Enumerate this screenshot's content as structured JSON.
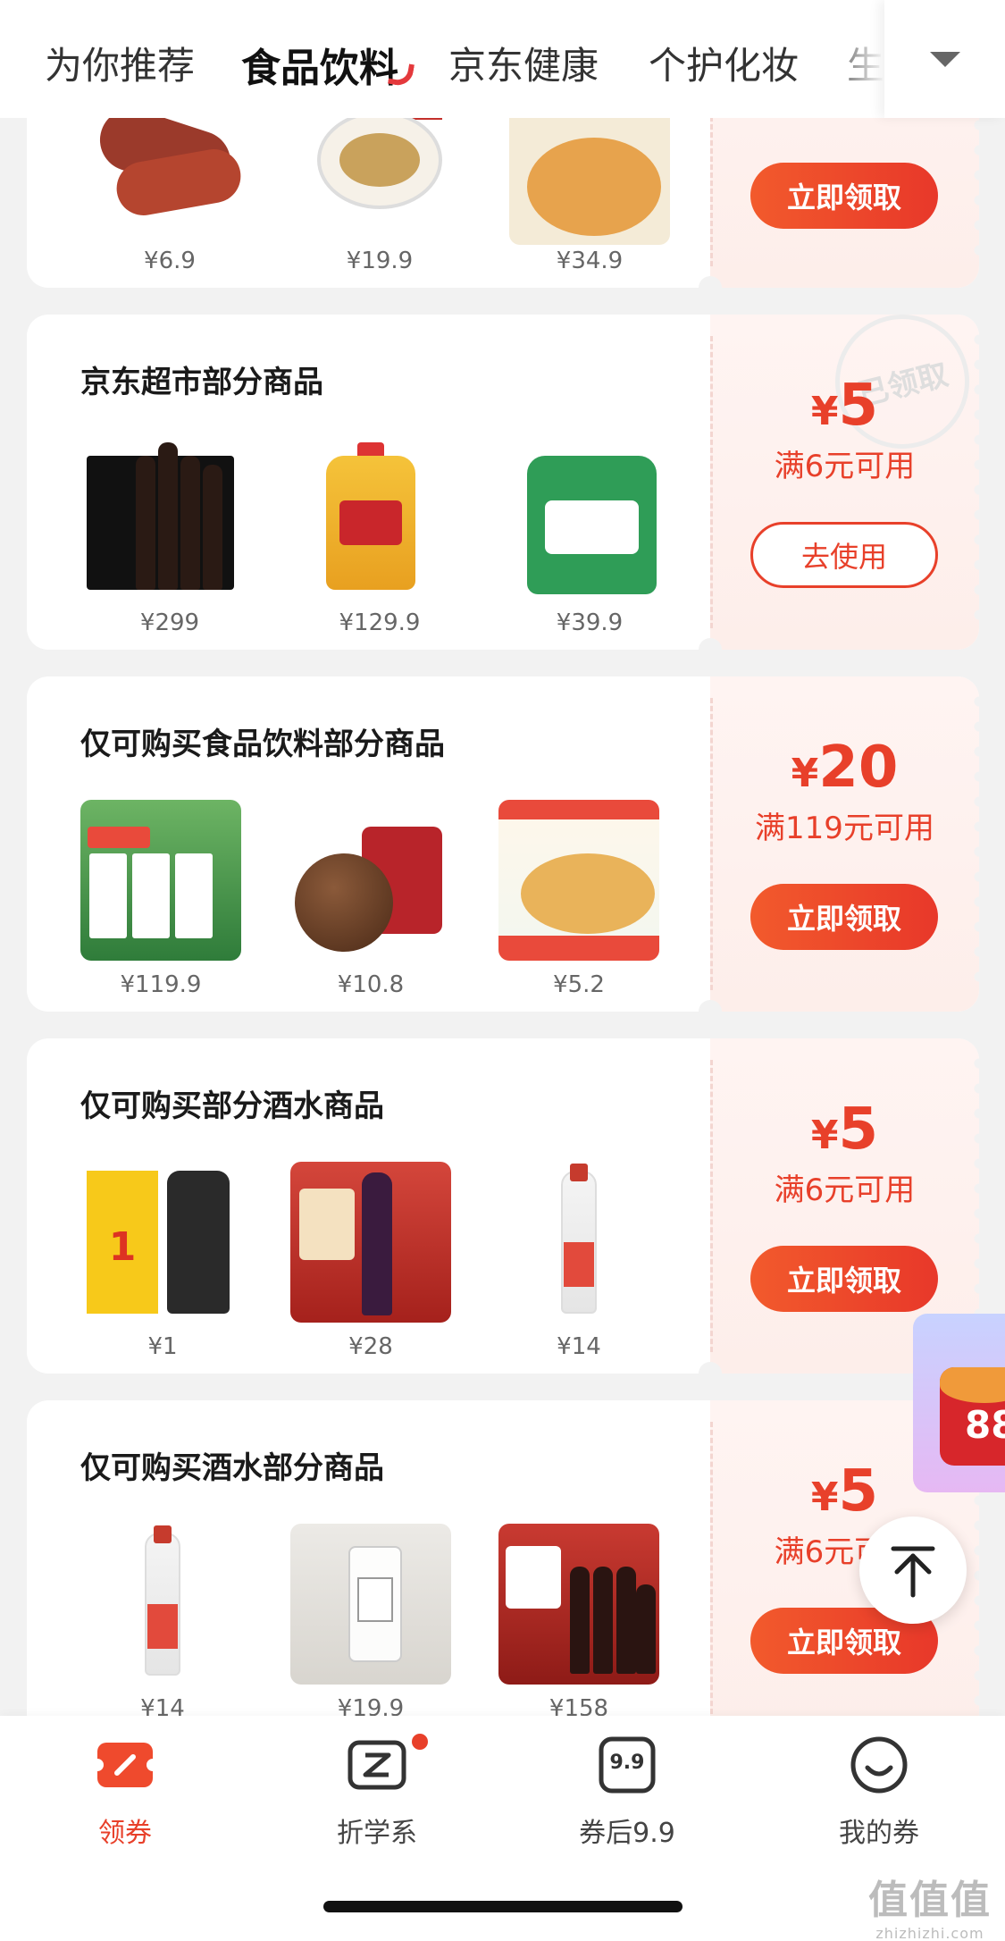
{
  "tabs": [
    {
      "label": "为你推荐",
      "active": false
    },
    {
      "label": "食品饮料",
      "active": true
    },
    {
      "label": "京东健康",
      "active": false
    },
    {
      "label": "个护化妆",
      "active": false
    },
    {
      "label": "生",
      "active": false
    }
  ],
  "cards": [
    {
      "title": "",
      "products": [
        {
          "price": "¥6.9",
          "icon": "sausage-image"
        },
        {
          "price": "¥19.9",
          "icon": "noodle-image"
        },
        {
          "price": "¥34.9",
          "icon": "rice-noodle-image"
        }
      ],
      "button": "立即领取"
    },
    {
      "title": "京东超市部分商品",
      "products": [
        {
          "price": "¥299",
          "icon": "wine-box-image"
        },
        {
          "price": "¥129.9",
          "icon": "cooking-oil-image"
        },
        {
          "price": "¥39.9",
          "icon": "rice-bag-image"
        }
      ],
      "amount_symbol": "¥",
      "amount": "5",
      "condition": "满6元可用",
      "button": "去使用",
      "stamp": "已领取"
    },
    {
      "title": "仅可购买食品饮料部分商品",
      "products": [
        {
          "price": "¥119.9",
          "icon": "milk-image"
        },
        {
          "price": "¥10.8",
          "icon": "longan-image"
        },
        {
          "price": "¥5.2",
          "icon": "nuts-image"
        }
      ],
      "amount_symbol": "¥",
      "amount": "20",
      "condition": "满119元可用",
      "button": "立即领取"
    },
    {
      "title": "仅可购买部分酒水商品",
      "products": [
        {
          "price": "¥1",
          "icon": "trial-liquor-image",
          "badge": "1"
        },
        {
          "price": "¥28",
          "icon": "red-wine-image"
        },
        {
          "price": "¥14",
          "icon": "baijiu-image"
        }
      ],
      "amount_symbol": "¥",
      "amount": "5",
      "condition": "满6元可用",
      "button": "立即领取"
    },
    {
      "title": "仅可购买酒水部分商品",
      "products": [
        {
          "price": "¥14",
          "icon": "baijiu-image"
        },
        {
          "price": "¥19.9",
          "icon": "white-liquor-image"
        },
        {
          "price": "¥158",
          "icon": "wine-set-image"
        }
      ],
      "amount_symbol": "¥",
      "amount": "5",
      "condition": "满6元可用",
      "button": "立即领取"
    }
  ],
  "floating": {
    "red_packet_number": "88",
    "back_to_top_icon": "arrow-up-icon"
  },
  "bottom_nav": [
    {
      "label": "领券",
      "icon": "coupon-icon",
      "active": true
    },
    {
      "label": "折学系",
      "icon": "z-icon",
      "badge_dot": true
    },
    {
      "label": "券后9.9",
      "icon": "ticket-99-icon",
      "icon_text": "9.9"
    },
    {
      "label": "我的券",
      "icon": "smile-icon"
    }
  ],
  "watermark": {
    "logo": "值值值",
    "url": "zhizhizhi.com"
  },
  "colors": {
    "accent": "#e8402a",
    "background": "#f2f2f2"
  }
}
